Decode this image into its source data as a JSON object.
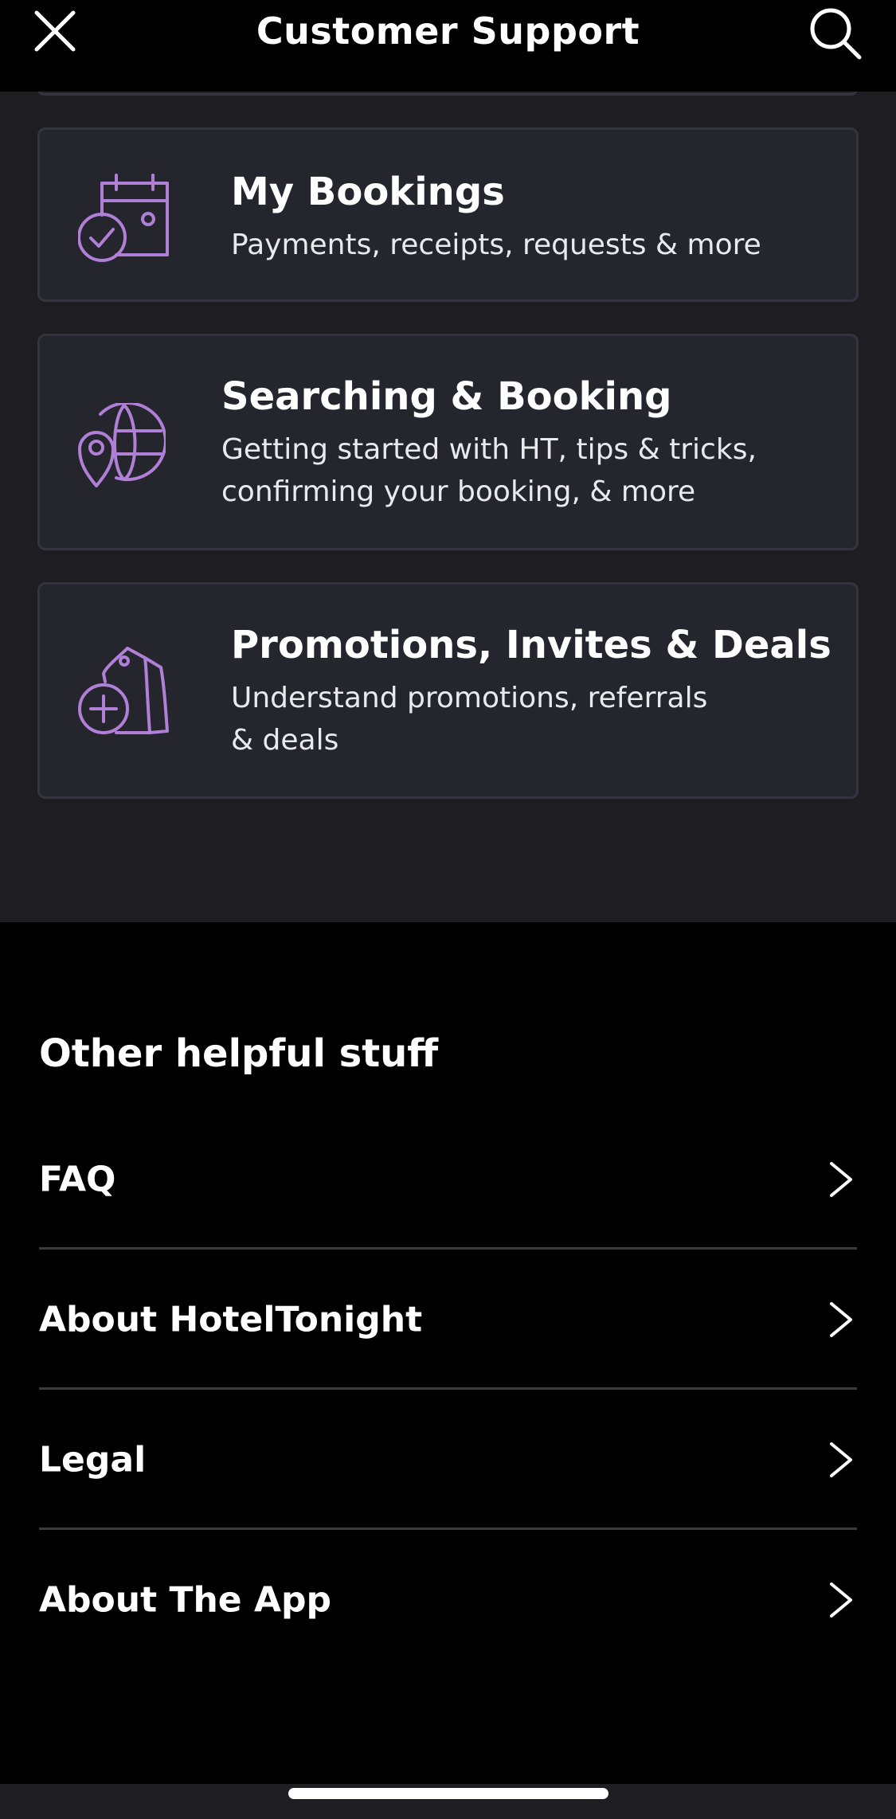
{
  "header": {
    "title": "Customer Support",
    "close_icon": "close-icon",
    "search_icon": "search-icon"
  },
  "cards": [
    {
      "title": "My Bookings",
      "description": "Payments, receipts, requests & more",
      "icon": "calendar-check-icon"
    },
    {
      "title": "Searching & Booking",
      "description": "Getting started with HT, tips & tricks,\nconfirming your booking, & more",
      "icon": "globe-pin-icon"
    },
    {
      "title": "Promotions, Invites & Deals",
      "description": "Understand promotions, referrals\n& deals",
      "icon": "tag-plus-icon"
    }
  ],
  "other": {
    "heading": "Other helpful stuff",
    "items": [
      {
        "label": "FAQ"
      },
      {
        "label": "About HotelTonight"
      },
      {
        "label": "Legal"
      },
      {
        "label": "About The App"
      }
    ],
    "chevron_icon": "chevron-right-icon"
  },
  "colors": {
    "accent": "#b07fd6",
    "card_bg": "#25252e",
    "section_bg": "#1e1e22"
  }
}
